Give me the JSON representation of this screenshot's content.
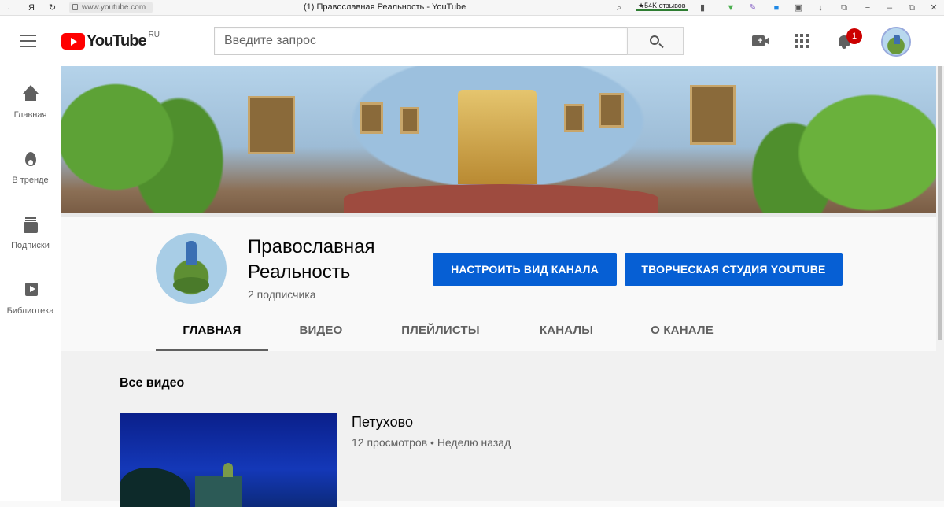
{
  "browser": {
    "back": "←",
    "ya": "Я",
    "reload": "↻",
    "url": "www.youtube.com",
    "tab_title": "(1) Православная Реальность - YouTube",
    "reviews": "★54K отзывов"
  },
  "masthead": {
    "logo_text": "YouTube",
    "logo_region": "RU",
    "search_placeholder": "Введите запрос",
    "notification_count": "1"
  },
  "guide": {
    "items": [
      {
        "label": "Главная",
        "icon": "home-icon"
      },
      {
        "label": "В тренде",
        "icon": "flame-icon"
      },
      {
        "label": "Подписки",
        "icon": "subscriptions-icon"
      },
      {
        "label": "Библиотека",
        "icon": "library-icon"
      }
    ]
  },
  "channel": {
    "name": "Православная Реальность",
    "subscribers": "2 подписчика",
    "customize_button": "НАСТРОИТЬ ВИД КАНАЛА",
    "studio_button": "ТВОРЧЕСКАЯ СТУДИЯ YOUTUBE",
    "tabs": [
      {
        "label": "ГЛАВНАЯ",
        "active": true
      },
      {
        "label": "ВИДЕО",
        "active": false
      },
      {
        "label": "ПЛЕЙЛИСТЫ",
        "active": false
      },
      {
        "label": "КАНАЛЫ",
        "active": false
      },
      {
        "label": "О КАНАЛЕ",
        "active": false
      }
    ]
  },
  "section": {
    "title": "Все видео",
    "videos": [
      {
        "title": "Петухово",
        "meta": "12 просмотров • Неделю назад"
      }
    ]
  },
  "colors": {
    "accent_button": "#065fd4",
    "logo_red": "#ff0000",
    "badge_red": "#cc0000"
  }
}
